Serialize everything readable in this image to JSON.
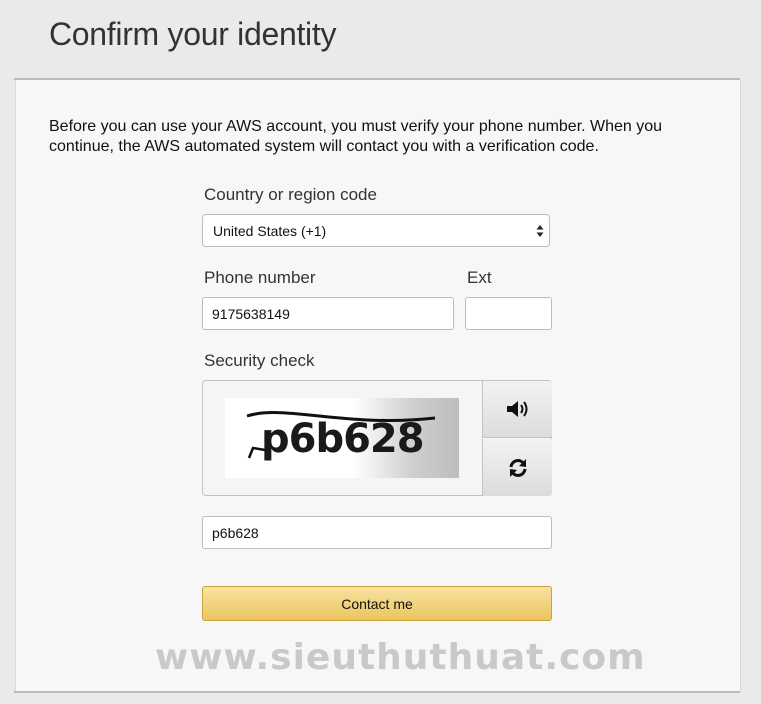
{
  "header": {
    "title": "Confirm your identity"
  },
  "intro": {
    "text": "Before you can use your AWS account, you must verify your phone number. When you continue, the AWS automated system will contact you with a verification code."
  },
  "form": {
    "country_label": "Country or region code",
    "country_value": "United States (+1)",
    "phone_label": "Phone number",
    "phone_value": "9175638149",
    "ext_label": "Ext",
    "ext_value": "",
    "security_label": "Security check",
    "captcha_text": "p6b628",
    "captcha_input_value": "p6b628",
    "audio_icon": "speaker-icon",
    "refresh_icon": "refresh-icon",
    "submit_label": "Contact me"
  },
  "watermark": {
    "text": "www.sieuthuthuat.com"
  }
}
